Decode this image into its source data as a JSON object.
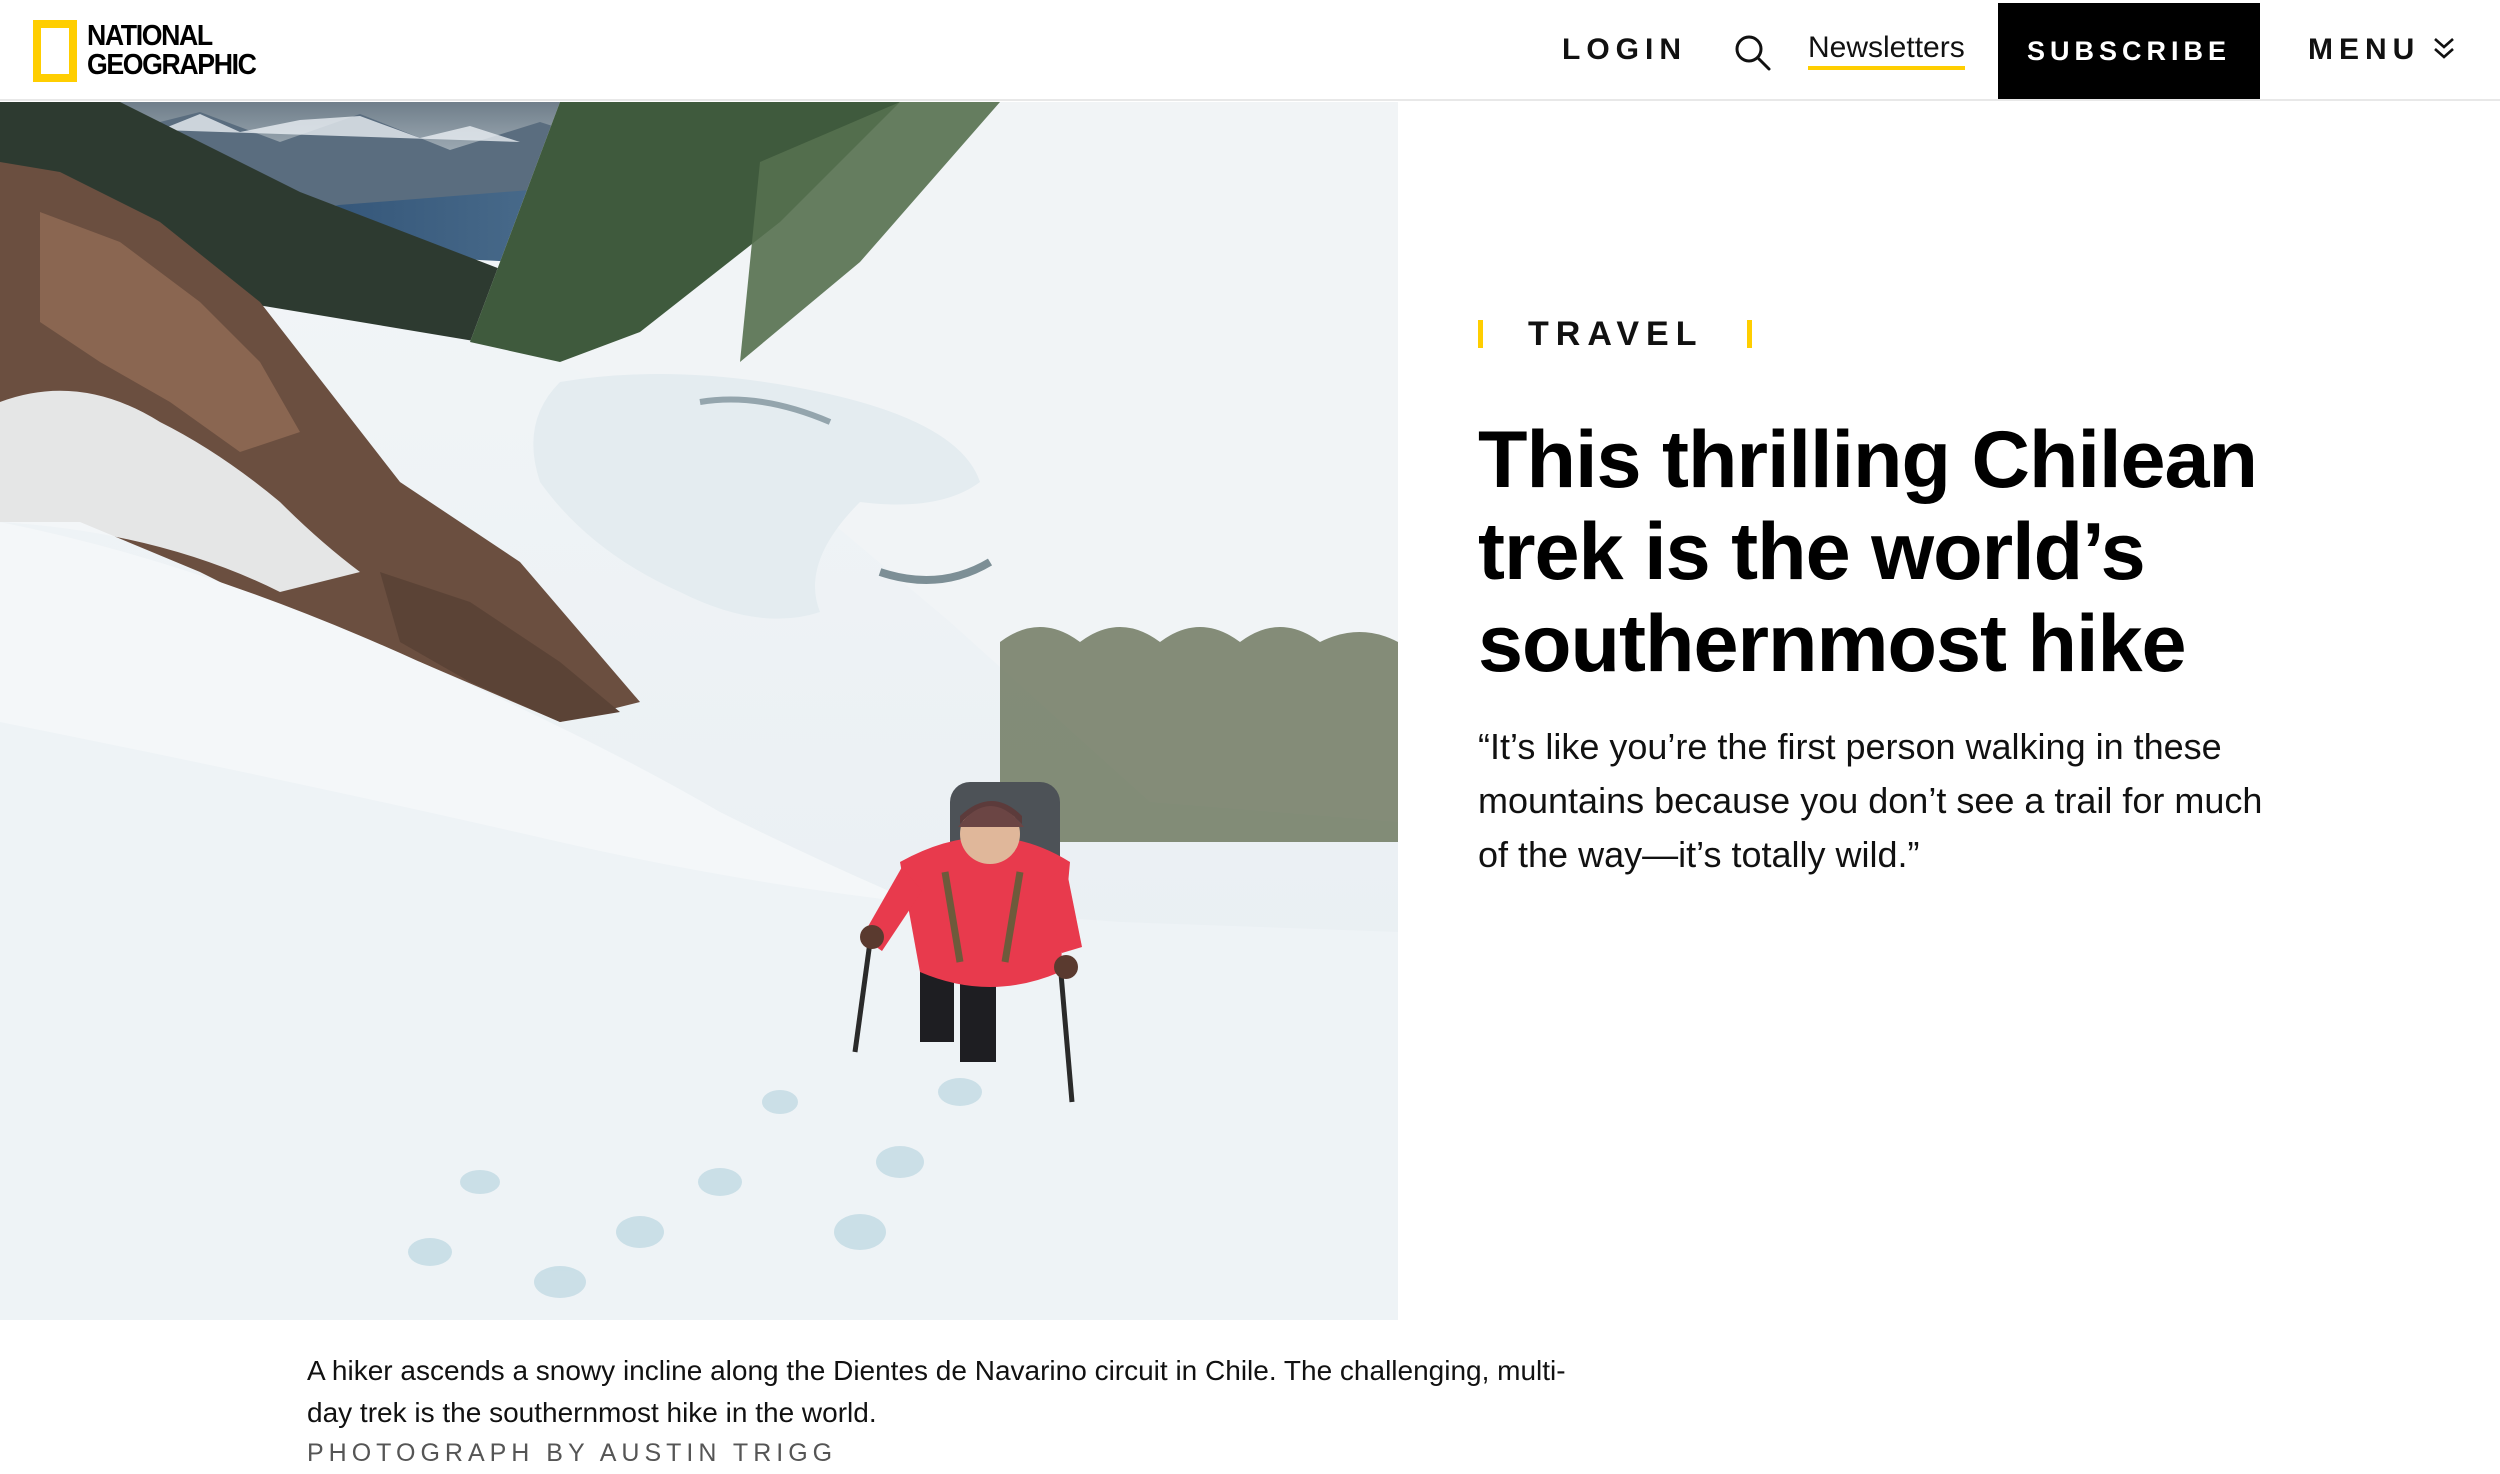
{
  "brand": {
    "logo_line1": "NATIONAL",
    "logo_line2": "GEOGRAPHIC",
    "accent_color": "#FFCE00"
  },
  "nav": {
    "login": "LOGIN",
    "search_icon": "search-icon",
    "newsletters": "Newsletters",
    "subscribe": "SUBSCRIBE",
    "menu": "MENU",
    "menu_icon": "chevron-down-icon"
  },
  "article": {
    "section": "TRAVEL",
    "headline": "This thrilling Chilean trek is the world’s southernmost hike",
    "dek": "“It’s like you’re the first person walking in these mountains because you don’t see a trail for much of the way—it’s totally wild.”"
  },
  "hero": {
    "caption": "A hiker ascends a snowy incline along the Dientes de Navarino circuit in Chile. The challenging, multi-day trek is the southernmost hike in the world.",
    "credit": "PHOTOGRAPH BY AUSTIN TRIGG"
  }
}
